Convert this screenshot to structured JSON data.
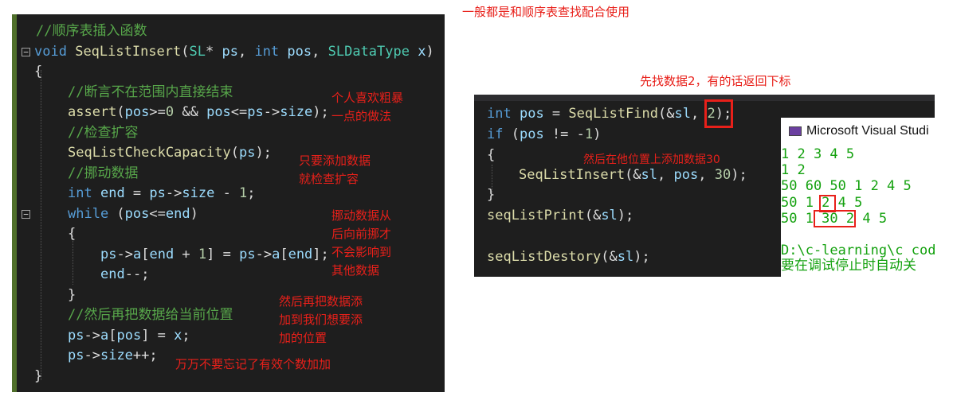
{
  "left_editor": {
    "lines": [
      {
        "parts": [
          {
            "c": "cm",
            "t": "//顺序表插入函数"
          }
        ]
      },
      {
        "parts": [
          {
            "c": "kw",
            "t": "void"
          },
          {
            "c": "",
            "t": " "
          },
          {
            "c": "fn",
            "t": "SeqListInsert"
          },
          {
            "c": "",
            "t": "("
          },
          {
            "c": "ty",
            "t": "SL"
          },
          {
            "c": "",
            "t": "* "
          },
          {
            "c": "vr",
            "t": "ps"
          },
          {
            "c": "",
            "t": ", "
          },
          {
            "c": "kw",
            "t": "int"
          },
          {
            "c": "",
            "t": " "
          },
          {
            "c": "vr",
            "t": "pos"
          },
          {
            "c": "",
            "t": ", "
          },
          {
            "c": "ty",
            "t": "SLDataType"
          },
          {
            "c": "",
            "t": " "
          },
          {
            "c": "vr",
            "t": "x"
          },
          {
            "c": "",
            "t": ")"
          }
        ]
      },
      {
        "parts": [
          {
            "c": "",
            "t": "{"
          }
        ]
      },
      {
        "parts": [
          {
            "c": "cm",
            "t": "//断言不在范围内直接结束"
          }
        ]
      },
      {
        "parts": [
          {
            "c": "fn",
            "t": "assert"
          },
          {
            "c": "",
            "t": "("
          },
          {
            "c": "vr",
            "t": "pos"
          },
          {
            "c": "",
            "t": ">="
          },
          {
            "c": "nm",
            "t": "0"
          },
          {
            "c": "",
            "t": " && "
          },
          {
            "c": "vr",
            "t": "pos"
          },
          {
            "c": "",
            "t": "<="
          },
          {
            "c": "vr",
            "t": "ps"
          },
          {
            "c": "",
            "t": "->"
          },
          {
            "c": "vr",
            "t": "size"
          },
          {
            "c": "",
            "t": ");"
          }
        ]
      },
      {
        "parts": [
          {
            "c": "cm",
            "t": "//检查扩容"
          }
        ]
      },
      {
        "parts": [
          {
            "c": "fn",
            "t": "SeqListCheckCapacity"
          },
          {
            "c": "",
            "t": "("
          },
          {
            "c": "vr",
            "t": "ps"
          },
          {
            "c": "",
            "t": ");"
          }
        ]
      },
      {
        "parts": [
          {
            "c": "cm",
            "t": "//挪动数据"
          }
        ]
      },
      {
        "parts": [
          {
            "c": "kw",
            "t": "int"
          },
          {
            "c": "",
            "t": " "
          },
          {
            "c": "vr",
            "t": "end"
          },
          {
            "c": "",
            "t": " = "
          },
          {
            "c": "vr",
            "t": "ps"
          },
          {
            "c": "",
            "t": "->"
          },
          {
            "c": "vr",
            "t": "size"
          },
          {
            "c": "",
            "t": " - "
          },
          {
            "c": "nm",
            "t": "1"
          },
          {
            "c": "",
            "t": ";"
          }
        ]
      },
      {
        "parts": [
          {
            "c": "kw",
            "t": "while"
          },
          {
            "c": "",
            "t": " ("
          },
          {
            "c": "vr",
            "t": "pos"
          },
          {
            "c": "",
            "t": "<="
          },
          {
            "c": "vr",
            "t": "end"
          },
          {
            "c": "",
            "t": ")"
          }
        ]
      },
      {
        "parts": [
          {
            "c": "",
            "t": "{"
          }
        ]
      },
      {
        "parts": [
          {
            "c": "vr",
            "t": "ps"
          },
          {
            "c": "",
            "t": "->"
          },
          {
            "c": "vr",
            "t": "a"
          },
          {
            "c": "",
            "t": "["
          },
          {
            "c": "vr",
            "t": "end"
          },
          {
            "c": "",
            "t": " + "
          },
          {
            "c": "nm",
            "t": "1"
          },
          {
            "c": "",
            "t": "] = "
          },
          {
            "c": "vr",
            "t": "ps"
          },
          {
            "c": "",
            "t": "->"
          },
          {
            "c": "vr",
            "t": "a"
          },
          {
            "c": "",
            "t": "["
          },
          {
            "c": "vr",
            "t": "end"
          },
          {
            "c": "",
            "t": "];"
          }
        ]
      },
      {
        "parts": [
          {
            "c": "vr",
            "t": "end"
          },
          {
            "c": "",
            "t": "--;"
          }
        ]
      },
      {
        "parts": [
          {
            "c": "",
            "t": "}"
          }
        ]
      },
      {
        "parts": [
          {
            "c": "cm",
            "t": "//然后再把数据给当前位置"
          }
        ]
      },
      {
        "parts": [
          {
            "c": "vr",
            "t": "ps"
          },
          {
            "c": "",
            "t": "->"
          },
          {
            "c": "vr",
            "t": "a"
          },
          {
            "c": "",
            "t": "["
          },
          {
            "c": "vr",
            "t": "pos"
          },
          {
            "c": "",
            "t": "] = "
          },
          {
            "c": "vr",
            "t": "x"
          },
          {
            "c": "",
            "t": ";"
          }
        ]
      },
      {
        "parts": [
          {
            "c": "vr",
            "t": "ps"
          },
          {
            "c": "",
            "t": "->"
          },
          {
            "c": "vr",
            "t": "size"
          },
          {
            "c": "",
            "t": "++;"
          }
        ]
      },
      {
        "parts": [
          {
            "c": "",
            "t": "}"
          }
        ]
      }
    ]
  },
  "annotations": {
    "rough": "个人喜欢粗暴\n一点的做法",
    "check_capacity": "只要添加数据\n就检查扩容",
    "move_data": "挪动数据从\n后向前挪才\n不会影响到\n其他数据",
    "put_data": "然后再把数据添\n加到我们想要添\n加的位置",
    "size_inc": "万万不要忘记了有效个数加加",
    "top_note": "一般都是和顺序表查找配合使用",
    "find_note": "先找数据2，有的话返回下标",
    "insert_note": "然后在他位置上添加数据30"
  },
  "right_code": {
    "lines": [
      {
        "parts": [
          {
            "c": "kw",
            "t": "int"
          },
          {
            "c": "",
            "t": " "
          },
          {
            "c": "vr",
            "t": "pos"
          },
          {
            "c": "",
            "t": " = "
          },
          {
            "c": "fn",
            "t": "SeqListFind"
          },
          {
            "c": "",
            "t": "(&"
          },
          {
            "c": "vr",
            "t": "sl"
          },
          {
            "c": "",
            "t": ", "
          },
          {
            "c": "nm",
            "t": "2"
          },
          {
            "c": "",
            "t": ");"
          }
        ]
      },
      {
        "parts": [
          {
            "c": "kw",
            "t": "if"
          },
          {
            "c": "",
            "t": " ("
          },
          {
            "c": "vr",
            "t": "pos"
          },
          {
            "c": "",
            "t": " != "
          },
          {
            "c": "",
            "t": "-"
          },
          {
            "c": "nm",
            "t": "1"
          },
          {
            "c": "",
            "t": ")"
          }
        ]
      },
      {
        "parts": [
          {
            "c": "",
            "t": "{"
          }
        ]
      },
      {
        "parts": [
          {
            "c": "fn",
            "t": "SeqListInsert"
          },
          {
            "c": "",
            "t": "(&"
          },
          {
            "c": "vr",
            "t": "sl"
          },
          {
            "c": "",
            "t": ", "
          },
          {
            "c": "vr",
            "t": "pos"
          },
          {
            "c": "",
            "t": ", "
          },
          {
            "c": "nm",
            "t": "30"
          },
          {
            "c": "",
            "t": ");"
          }
        ]
      },
      {
        "parts": [
          {
            "c": "",
            "t": "}"
          }
        ]
      },
      {
        "parts": [
          {
            "c": "fn",
            "t": "seqListPrint"
          },
          {
            "c": "",
            "t": "(&"
          },
          {
            "c": "vr",
            "t": "sl"
          },
          {
            "c": "",
            "t": ");"
          }
        ]
      },
      {
        "parts": []
      },
      {
        "parts": [
          {
            "c": "fn",
            "t": "seqListDestory"
          },
          {
            "c": "",
            "t": "(&"
          },
          {
            "c": "vr",
            "t": "sl"
          },
          {
            "c": "",
            "t": ");"
          }
        ]
      }
    ]
  },
  "console": {
    "title": "Microsoft Visual Studi",
    "icon": "console-app-icon",
    "lines": [
      "1 2 3 4 5",
      "1 2",
      "50 60 50 1 2 4 5",
      "50 1 2 4 5",
      "50 1 30 2 4 5",
      "",
      "D:\\c-learning\\c code",
      "要在调试停止时自动关"
    ]
  },
  "colors": {
    "keyword": "#569cd6",
    "type": "#4ec9b0",
    "function": "#dcdcaa",
    "comment": "#57a64a",
    "number": "#b5cea8",
    "variable": "#9cdcfe",
    "annotation": "#e8201a",
    "console_text": "#13a10e"
  }
}
